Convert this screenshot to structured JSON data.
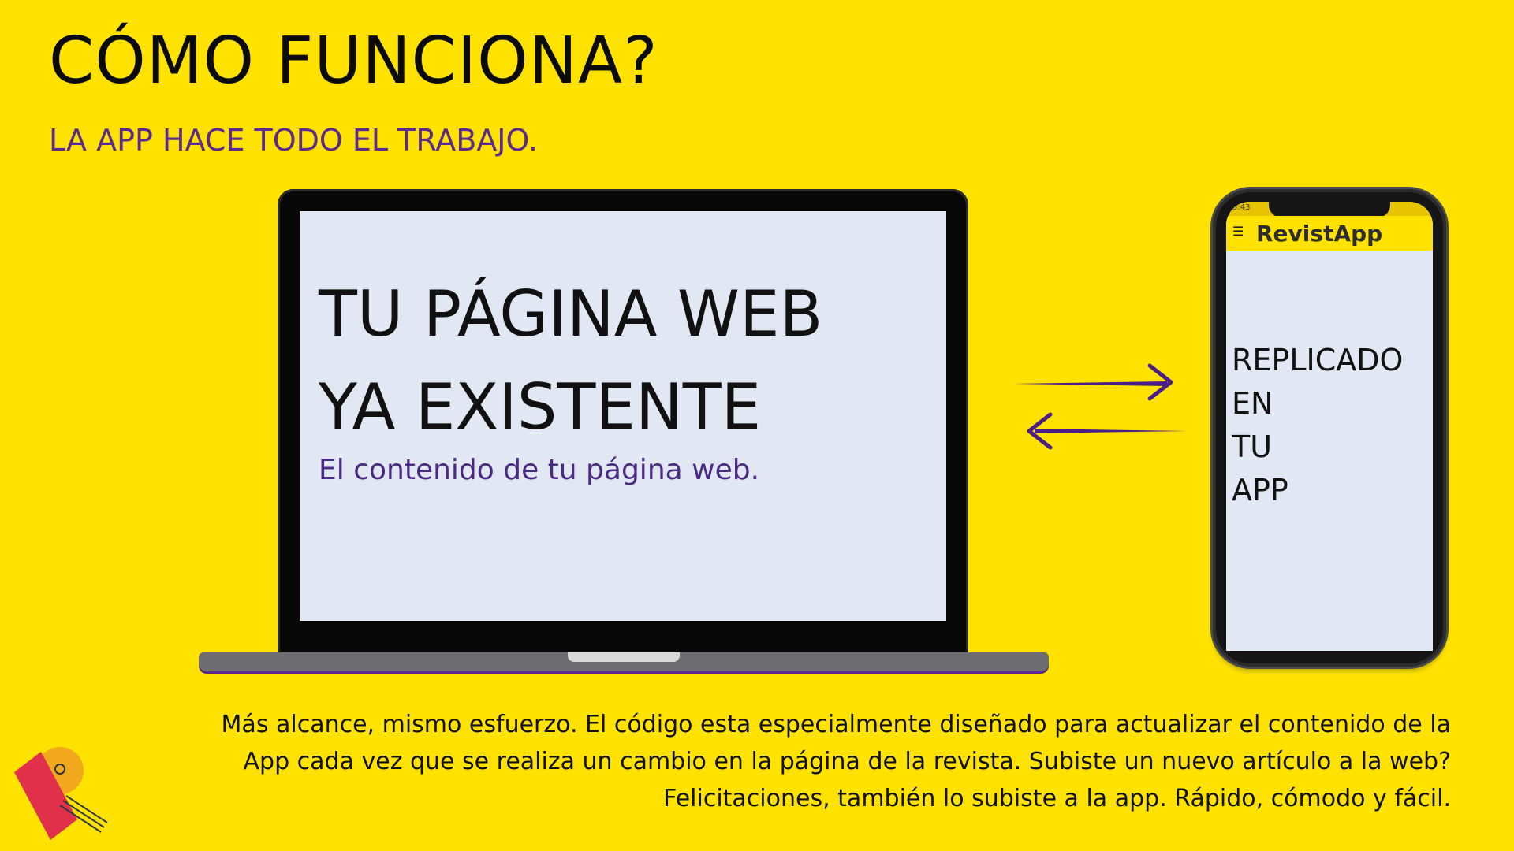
{
  "header": {
    "title": "CÓMO FUNCIONA?",
    "subtitle": "LA APP HACE TODO EL TRABAJO."
  },
  "laptop": {
    "screen_title_line1": "TU PÁGINA WEB",
    "screen_title_line2": "YA EXISTENTE",
    "screen_subtitle": "El contenido de tu página web."
  },
  "arrows": {
    "top_direction": "right",
    "bottom_direction": "left",
    "color": "#4b1d86"
  },
  "phone": {
    "status_time": "5:43",
    "menu_icon": "hamburger-icon",
    "app_title": "RevistApp",
    "lines": [
      "REPLICADO",
      "EN",
      "TU",
      "APP"
    ]
  },
  "footer": {
    "line1": "Más alcance, mismo esfuerzo.  El código esta especialmente diseñado para actualizar el contenido de la",
    "line2": "App cada vez que se realiza un cambio en la página de la revista. Subiste un nuevo artículo a la web?",
    "line3": "Felicitaciones, también lo subiste a la app. Rápido, cómodo y fácil."
  },
  "colors": {
    "background": "#ffe200",
    "accent_purple": "#5a2b8c",
    "screen": "#e1e8f4"
  },
  "logo": {
    "icon": "revistapp-logo-icon"
  }
}
